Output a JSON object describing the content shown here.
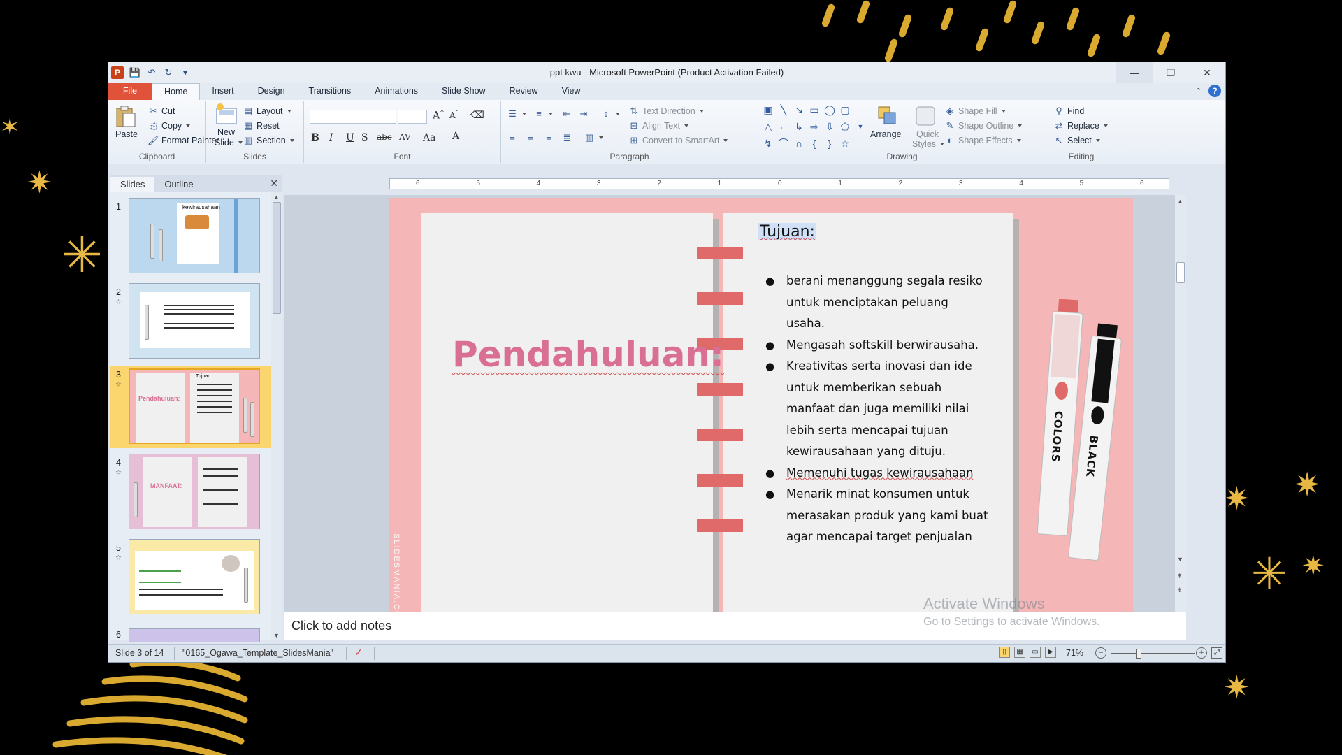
{
  "window": {
    "title": "ppt kwu  -  Microsoft PowerPoint (Product Activation Failed)",
    "app_icon": "powerpoint-icon",
    "quick_access": [
      "save-icon",
      "undo-icon",
      "redo-icon",
      "customize-icon"
    ]
  },
  "tabs": [
    {
      "label": "File"
    },
    {
      "label": "Home"
    },
    {
      "label": "Insert"
    },
    {
      "label": "Design"
    },
    {
      "label": "Transitions"
    },
    {
      "label": "Animations"
    },
    {
      "label": "Slide Show"
    },
    {
      "label": "Review"
    },
    {
      "label": "View"
    }
  ],
  "ribbon": {
    "clipboard": {
      "label": "Clipboard",
      "paste": "Paste",
      "cut": "Cut",
      "copy": "Copy",
      "format_painter": "Format Painter"
    },
    "slides": {
      "label": "Slides",
      "new_slide": "New",
      "new_slide2": "Slide",
      "layout": "Layout",
      "reset": "Reset",
      "section": "Section"
    },
    "font": {
      "label": "Font"
    },
    "paragraph": {
      "label": "Paragraph",
      "text_direction": "Text Direction",
      "align_text": "Align Text",
      "smartart": "Convert to SmartArt"
    },
    "drawing": {
      "label": "Drawing",
      "arrange": "Arrange",
      "quick_styles": "Quick",
      "quick_styles2": "Styles",
      "shape_fill": "Shape Fill",
      "shape_outline": "Shape Outline",
      "shape_effects": "Shape Effects"
    },
    "editing": {
      "label": "Editing",
      "find": "Find",
      "replace": "Replace",
      "select": "Select"
    }
  },
  "slides_pane": {
    "tab_slides": "Slides",
    "tab_outline": "Outline",
    "thumbnails": [
      {
        "num": "1",
        "bg": "#bcd8ef"
      },
      {
        "num": "2",
        "bg": "#cfe3f1"
      },
      {
        "num": "3",
        "bg": "#f4b6b6"
      },
      {
        "num": "4",
        "bg": "#e6bfd6"
      },
      {
        "num": "5",
        "bg": "#fbe9a8"
      },
      {
        "num": "6",
        "bg": "#cdc3ea"
      }
    ],
    "thumb_texts": {
      "t1": "kewirausahaan",
      "t3a": "Pendahuluan:",
      "t3b": "Tujuan:",
      "t4": "MANFAAT:"
    }
  },
  "ruler": {
    "h_ticks": [
      "6",
      "5",
      "4",
      "3",
      "2",
      "1",
      "0",
      "1",
      "2",
      "3",
      "4",
      "5",
      "6"
    ]
  },
  "slide": {
    "heading": "Pendahuluan:",
    "subheading": "Tujuan:",
    "bullets": [
      "berani menanggung segala resiko untuk menciptakan peluang usaha.",
      "Mengasah softskill berwirausaha.",
      "Kreativitas serta inovasi dan ide untuk memberikan sebuah manfaat dan juga memiliki nilai lebih serta mencapai tujuan kewirausahaan yang dituju.",
      "Memenuhi tugas kewirausahaan",
      " Menarik minat konsumen untuk merasakan produk yang kami buat agar mencapai target penjualan"
    ],
    "credit": "SLIDESMANIA.COM",
    "marker1_label": "COLORS",
    "marker2_label": "BLACK",
    "colors": {
      "bg": "#f4b6b6",
      "heading": "#d96f93",
      "ring": "#e06a6a"
    }
  },
  "notes": {
    "placeholder": "Click to add notes"
  },
  "watermark": {
    "line1": "Activate Windows",
    "line2": "Go to Settings to activate Windows."
  },
  "status": {
    "slide_info": "Slide 3 of 14",
    "theme": "\"0165_Ogawa_Template_SlidesMania\"",
    "zoom": "71%"
  }
}
